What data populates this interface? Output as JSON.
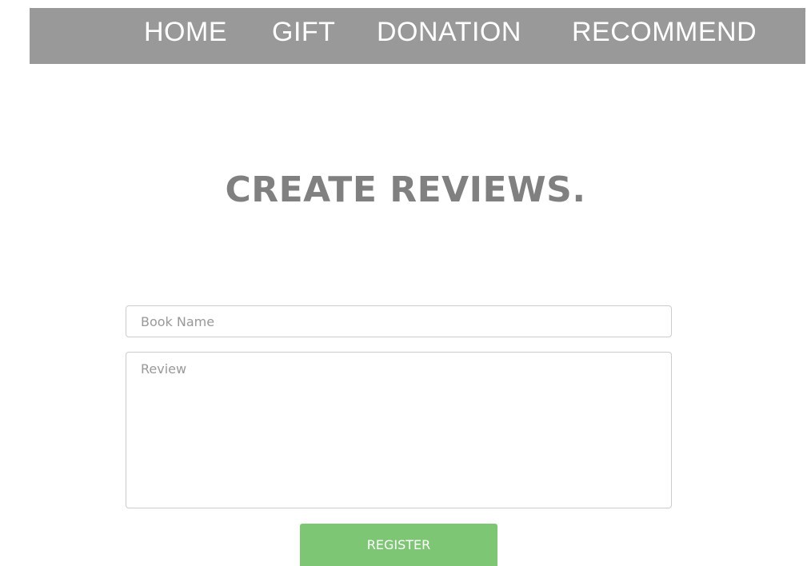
{
  "nav": {
    "items": [
      {
        "label": "HOME"
      },
      {
        "label": "GIFT"
      },
      {
        "label": "DONATION"
      },
      {
        "label": "RECOMMEND"
      }
    ]
  },
  "main": {
    "title": "CREATE REVIEWS."
  },
  "form": {
    "book_name": {
      "placeholder": "Book Name",
      "value": ""
    },
    "review": {
      "placeholder": "Review",
      "value": ""
    },
    "register_label": "REGISTER"
  },
  "colors": {
    "nav_background": "#999999",
    "title": "#808080",
    "button": "#7dc674"
  }
}
